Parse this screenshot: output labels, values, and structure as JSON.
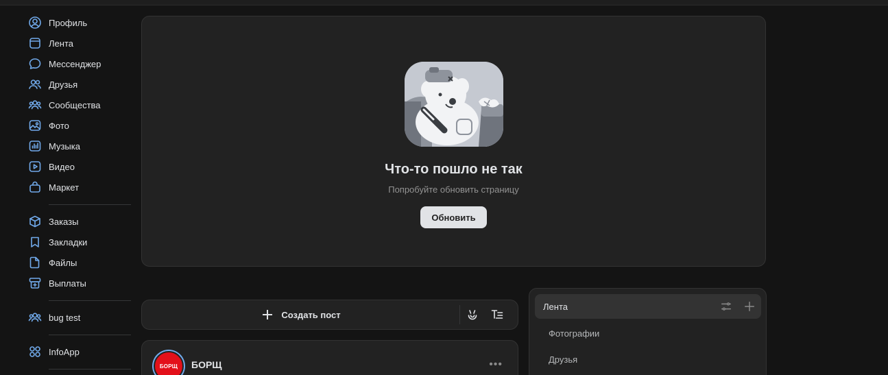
{
  "sidebar": {
    "group1": [
      {
        "label": "Профиль",
        "icon": "profile-icon"
      },
      {
        "label": "Лента",
        "icon": "feed-icon"
      },
      {
        "label": "Мессенджер",
        "icon": "messenger-icon"
      },
      {
        "label": "Друзья",
        "icon": "friends-icon"
      },
      {
        "label": "Сообщества",
        "icon": "communities-icon"
      },
      {
        "label": "Фото",
        "icon": "photo-icon"
      },
      {
        "label": "Музыка",
        "icon": "music-icon"
      },
      {
        "label": "Видео",
        "icon": "video-icon"
      },
      {
        "label": "Маркет",
        "icon": "market-icon"
      }
    ],
    "group2": [
      {
        "label": "Заказы",
        "icon": "orders-icon"
      },
      {
        "label": "Закладки",
        "icon": "bookmarks-icon"
      },
      {
        "label": "Файлы",
        "icon": "files-icon"
      },
      {
        "label": "Выплаты",
        "icon": "payouts-icon"
      }
    ],
    "group3": [
      {
        "label": "bug test",
        "icon": "community-icon"
      }
    ],
    "group4": [
      {
        "label": "InfoApp",
        "icon": "apps-icon"
      }
    ]
  },
  "error": {
    "title": "Что-то пошло не так",
    "subtitle": "Попробуйте обновить страницу",
    "button": "Обновить"
  },
  "composer": {
    "create_label": "Создать пост"
  },
  "post": {
    "author": "БОРЩ",
    "avatar_text": "БОРЩ",
    "more": "•••"
  },
  "filters": {
    "active": "Лента",
    "items": [
      "Фотографии",
      "Друзья"
    ]
  },
  "colors": {
    "accent": "#71aaeb",
    "background": "#141414",
    "card": "#222222",
    "avatar_red": "#e3101a"
  }
}
